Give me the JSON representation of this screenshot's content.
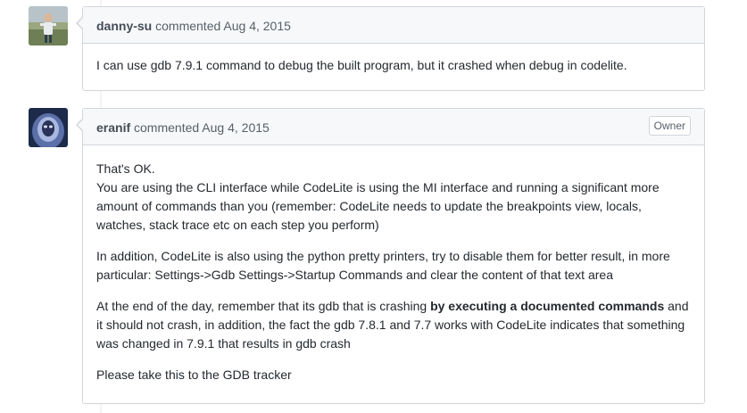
{
  "comments": [
    {
      "author": "danny-su",
      "action": "commented",
      "date": "Aug 4, 2015",
      "badge": "",
      "avatar": "avatar-photo-child",
      "body": [
        "I can use gdb 7.9.1 command to debug the built program, but it crashed when debug in codelite."
      ]
    },
    {
      "author": "eranif",
      "action": "commented",
      "date": "Aug 4, 2015",
      "badge": "Owner",
      "avatar": "avatar-photo-hooded-figure",
      "body": {
        "p1_line1": "That's OK.",
        "p1_line2": "You are using the CLI interface while CodeLite is using the MI interface and running a significant more amount of commands than you (remember: CodeLite needs to update the breakpoints view, locals, watches, stack trace etc on each step you perform)",
        "p2": "In addition, CodeLite is also using the python pretty printers, try to disable them for better result, in more particular: Settings->Gdb Settings->Startup Commands and clear the content of that text area",
        "p3_before": "At the end of the day, remember that its gdb that is crashing ",
        "p3_bold": "by executing a documented commands",
        "p3_after": " and it should not crash, in addition, the fact the gdb 7.8.1 and 7.7 works with CodeLite indicates that something was changed in 7.9.1 that results in gdb crash",
        "p4": "Please take this to the GDB tracker"
      }
    }
  ],
  "colors": {
    "header_bg": "#f6f8fa",
    "border": "#d1d5da",
    "author": "#444d56",
    "meta": "#586069",
    "text": "#24292e"
  }
}
